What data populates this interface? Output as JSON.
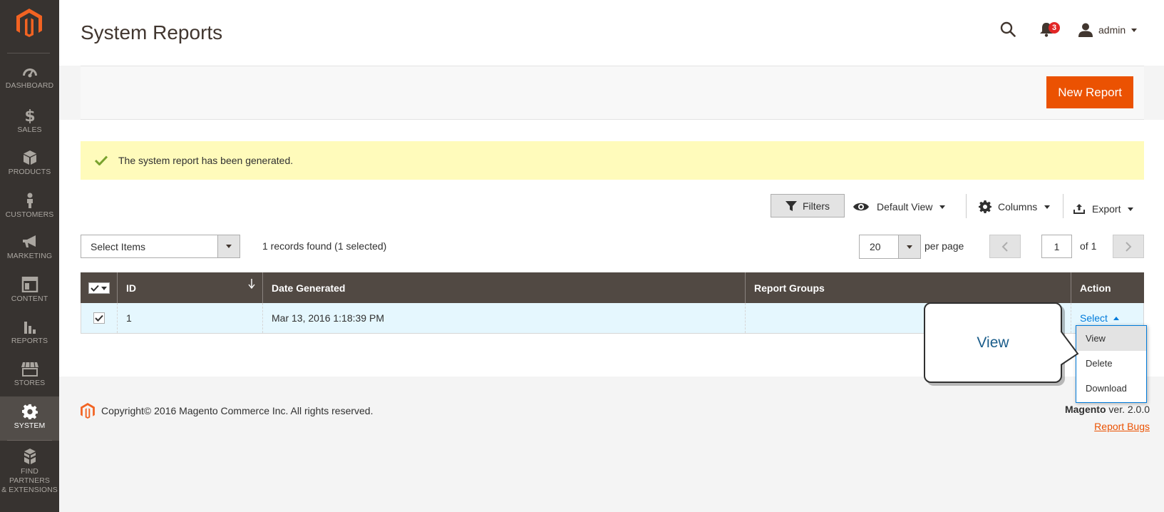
{
  "colors": {
    "sidebar": "#373330",
    "accent": "#eb5202",
    "grid_header": "#514943",
    "message_bg": "#fffbbb",
    "link": "#007bdb"
  },
  "sidebar": {
    "items": [
      {
        "label": "DASHBOARD",
        "icon": "dashboard-icon"
      },
      {
        "label": "SALES",
        "icon": "dollar-icon"
      },
      {
        "label": "PRODUCTS",
        "icon": "box-icon"
      },
      {
        "label": "CUSTOMERS",
        "icon": "person-icon"
      },
      {
        "label": "MARKETING",
        "icon": "megaphone-icon"
      },
      {
        "label": "CONTENT",
        "icon": "layout-icon"
      },
      {
        "label": "REPORTS",
        "icon": "bar-chart-icon"
      },
      {
        "label": "STORES",
        "icon": "store-icon"
      },
      {
        "label": "SYSTEM",
        "icon": "gear-icon",
        "active": true
      },
      {
        "label": "FIND PARTNERS",
        "label2": "& EXTENSIONS",
        "icon": "cubes-icon"
      }
    ]
  },
  "header": {
    "title": "System Reports",
    "notifications_count": "3",
    "user": "admin"
  },
  "actions": {
    "new_report_label": "New Report"
  },
  "message": {
    "text": "The system report has been generated."
  },
  "toolbar": {
    "filters_label": "Filters",
    "view_label": "Default View",
    "columns_label": "Columns",
    "export_label": "Export"
  },
  "mass_action": {
    "selected": "Select Items"
  },
  "records_text": "1 records found (1 selected)",
  "pagination": {
    "per_page": "20",
    "per_page_label": "per page",
    "current_page": "1",
    "of_label": "of 1"
  },
  "grid": {
    "columns": [
      "ID",
      "Date Generated",
      "Report Groups",
      "Action"
    ],
    "rows": [
      {
        "id": "1",
        "date": "Mar 13, 2016 1:18:39 PM",
        "groups": "",
        "action": "Select"
      }
    ]
  },
  "action_menu": {
    "items": [
      "View",
      "Delete",
      "Download"
    ]
  },
  "callout": {
    "text": "View"
  },
  "footer": {
    "copyright": "Copyright© 2016 Magento Commerce Inc. All rights reserved.",
    "brand": "Magento",
    "version": " ver. 2.0.0",
    "report_bugs": "Report Bugs"
  }
}
